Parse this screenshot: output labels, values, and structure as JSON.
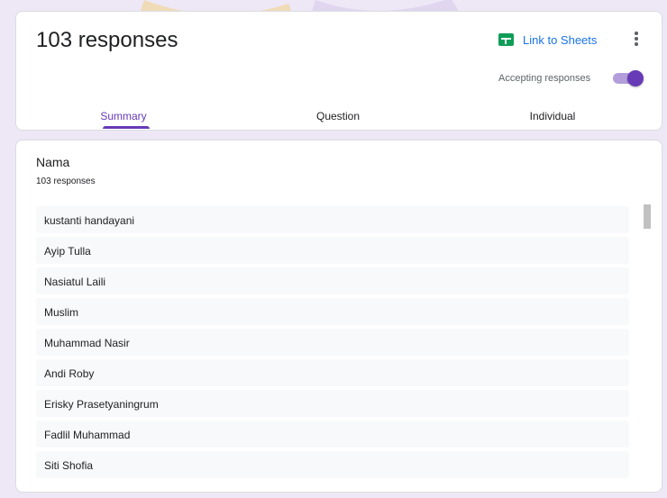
{
  "header": {
    "title": "103 responses",
    "link_sheets_label": "Link to Sheets",
    "sheets_icon": "google-sheets-icon",
    "more_icon": "more-vert-icon",
    "accepting_label": "Accepting responses",
    "accepting_on": true
  },
  "tabs": [
    {
      "label": "Summary",
      "active": true
    },
    {
      "label": "Question",
      "active": false
    },
    {
      "label": "Individual",
      "active": false
    }
  ],
  "question": {
    "title": "Nama",
    "count": "103 responses",
    "answers": [
      "kustanti handayani",
      "Ayip Tulla",
      "Nasiatul Laili",
      "Muslim",
      "Muhammad Nasir",
      "Andi Roby",
      "Erisky Prasetyaningrum",
      "Fadlil Muhammad",
      "Siti Shofia"
    ]
  },
  "colors": {
    "accent": "#673ab7",
    "page_background": "#ede7f6",
    "link": "#1a73e8",
    "sheets_green": "#0f9d58"
  }
}
